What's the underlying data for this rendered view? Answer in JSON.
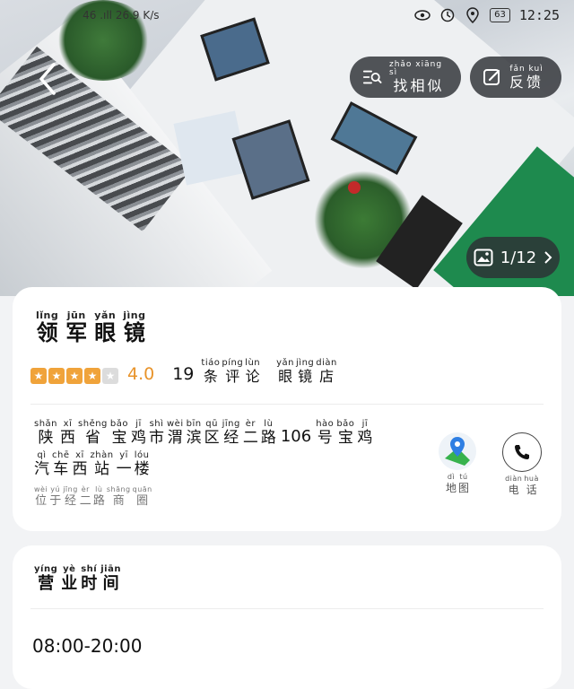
{
  "status_bar": {
    "signal": "46 .ıll",
    "speed": "26.9 K/s",
    "battery": "63",
    "time": "12:25"
  },
  "toolbar": {
    "find_similar": {
      "py": "zhǎo xiāng sì",
      "cn": "找相似"
    },
    "feedback": {
      "py": "fǎn kuì",
      "cn": "反馈"
    }
  },
  "gallery": {
    "counter": "1/12"
  },
  "store": {
    "name": [
      {
        "py": "lǐng",
        "cn": "领"
      },
      {
        "py": "jūn",
        "cn": "军"
      },
      {
        "py": "yǎn",
        "cn": "眼"
      },
      {
        "py": "jìng",
        "cn": "镜"
      }
    ],
    "rating": {
      "stars": 4,
      "max": 5,
      "score": "4.0"
    },
    "reviews_count": "19",
    "reviews_label": [
      {
        "py": "tiáo",
        "cn": "条"
      },
      {
        "py": "píng",
        "cn": "评"
      },
      {
        "py": "lùn",
        "cn": "论"
      }
    ],
    "category": [
      {
        "py": "yǎn",
        "cn": "眼"
      },
      {
        "py": "jìng",
        "cn": "镜"
      },
      {
        "py": "diàn",
        "cn": "店"
      }
    ],
    "address_line1": [
      {
        "py": "shǎn",
        "cn": "陕"
      },
      {
        "py": "xī",
        "cn": "西"
      },
      {
        "py": "shěng",
        "cn": "省"
      },
      {
        "py": "bǎo",
        "cn": "宝"
      },
      {
        "py": "jī",
        "cn": "鸡"
      },
      {
        "py": "shì",
        "cn": "市"
      },
      {
        "py": "wèi",
        "cn": "渭"
      },
      {
        "py": "bīn",
        "cn": "滨"
      },
      {
        "py": "qū",
        "cn": "区"
      },
      {
        "py": "jīng",
        "cn": "经"
      },
      {
        "py": "èr",
        "cn": "二"
      },
      {
        "py": "lù",
        "cn": "路"
      }
    ],
    "address_number": "106",
    "address_line1b": [
      {
        "py": "hào",
        "cn": "号"
      },
      {
        "py": "bǎo",
        "cn": "宝"
      },
      {
        "py": "jī",
        "cn": "鸡"
      }
    ],
    "address_line2": [
      {
        "py": "qì",
        "cn": "汽"
      },
      {
        "py": "chē",
        "cn": "车"
      },
      {
        "py": "xī",
        "cn": "西"
      },
      {
        "py": "zhàn",
        "cn": "站"
      },
      {
        "py": "yī",
        "cn": "一"
      },
      {
        "py": "lóu",
        "cn": "楼"
      }
    ],
    "nearby": [
      {
        "py": "wèi",
        "cn": "位"
      },
      {
        "py": "yú",
        "cn": "于"
      },
      {
        "py": "jīng",
        "cn": "经"
      },
      {
        "py": "èr",
        "cn": "二"
      },
      {
        "py": "lù",
        "cn": "路"
      },
      {
        "py": "shāng",
        "cn": "商"
      },
      {
        "py": "quān",
        "cn": "圈"
      }
    ],
    "map_label": [
      {
        "py": "dì",
        "cn": "地"
      },
      {
        "py": "tú",
        "cn": "图"
      }
    ],
    "call_label": [
      {
        "py": "diàn",
        "cn": "电"
      },
      {
        "py": "huà",
        "cn": "话"
      }
    ]
  },
  "hours": {
    "title": [
      {
        "py": "yíng",
        "cn": "营"
      },
      {
        "py": "yè",
        "cn": "业"
      },
      {
        "py": "shí",
        "cn": "时"
      },
      {
        "py": "jiān",
        "cn": "间"
      }
    ],
    "time": "08:00-20:00"
  },
  "colors": {
    "star": "#f0a33a",
    "score": "#e8932a",
    "map_pin": "#2f7fe3",
    "map_green": "#37b24d"
  }
}
